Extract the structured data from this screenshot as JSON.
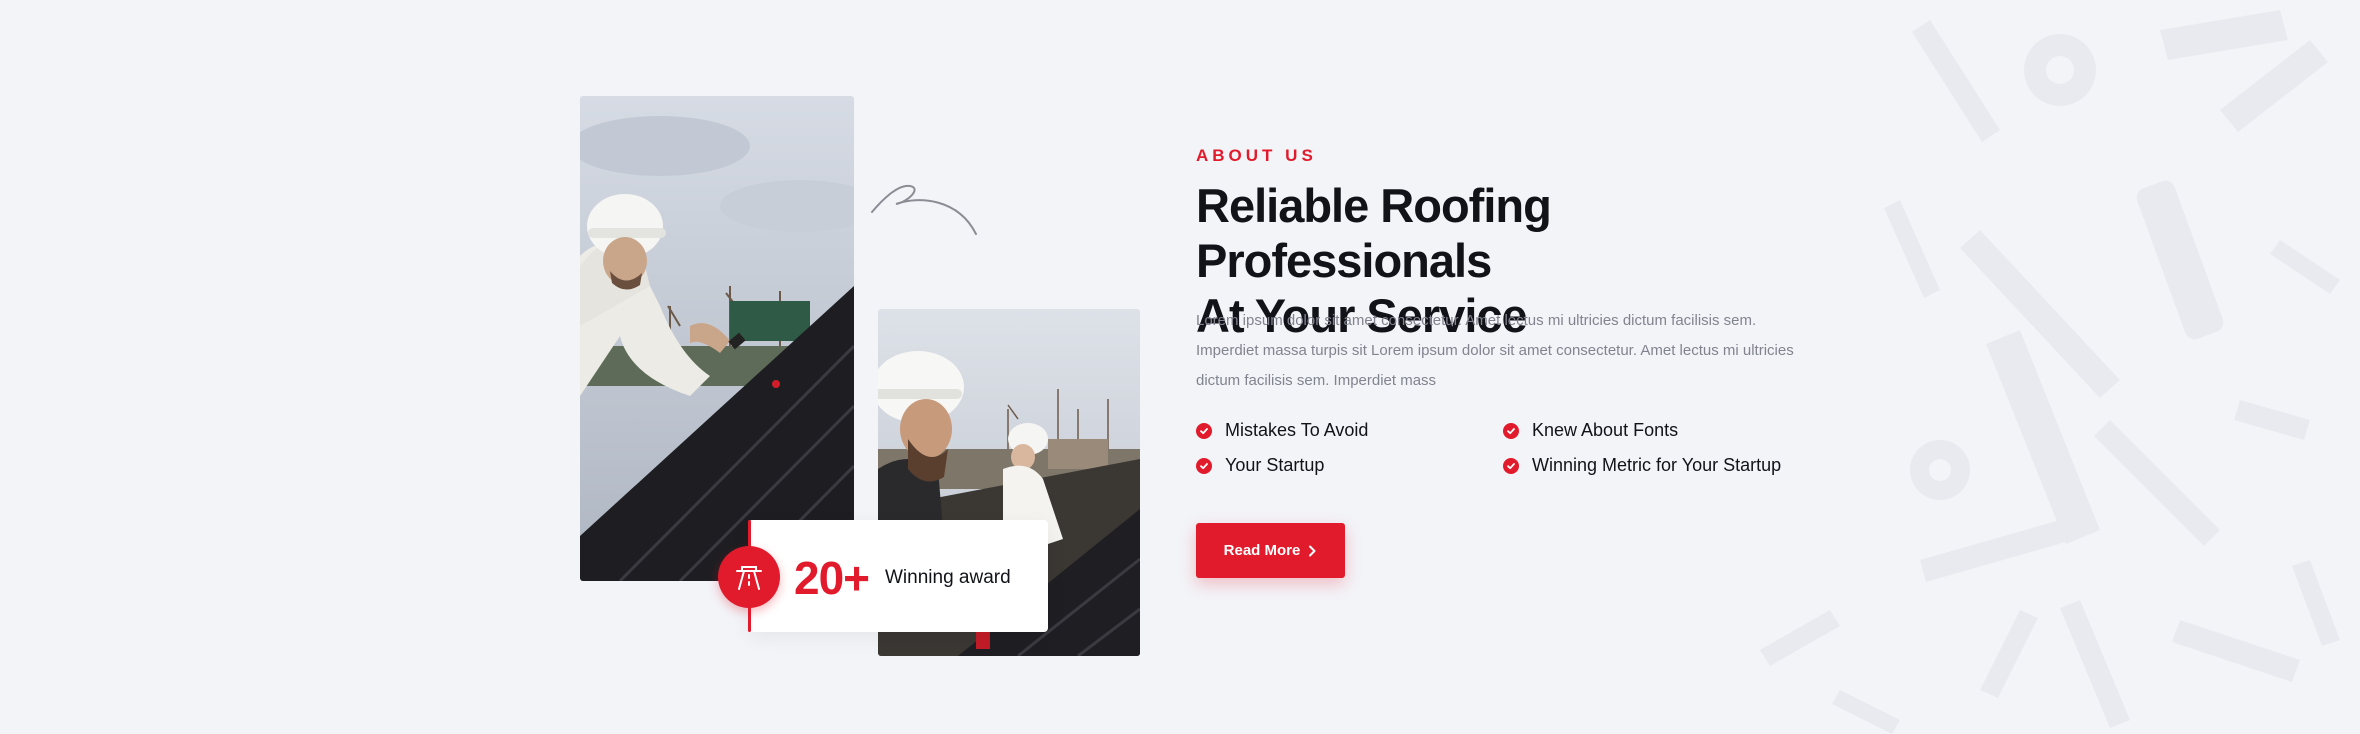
{
  "about": {
    "eyebrow": "ABOUT US",
    "title_line1": "Reliable Roofing Professionals",
    "title_line2": "At Your Service",
    "description": "Lorem ipsum dolor sit amet consectetur. Amet lectus mi ultricies dictum facilisis sem. Imperdiet massa turpis sit Lorem ipsum dolor sit amet consectetur. Amet lectus mi ultricies dictum facilisis sem. Imperdiet mass",
    "features": [
      "Mistakes To Avoid",
      "Knew About Fonts",
      "Your Startup",
      "Winning Metric for Your Startup"
    ],
    "cta_label": "Read More"
  },
  "award": {
    "number": "20+",
    "label": "Winning award",
    "icon": "road-icon"
  },
  "icons": {
    "check": "check-circle-icon",
    "chevron": "chevron-right-icon",
    "decoration": "squiggle-arrow",
    "background": "tools-pattern"
  },
  "colors": {
    "accent": "#e21b2c",
    "heading": "#111318",
    "body_text": "#80848f",
    "background": "#f3f4f8"
  }
}
